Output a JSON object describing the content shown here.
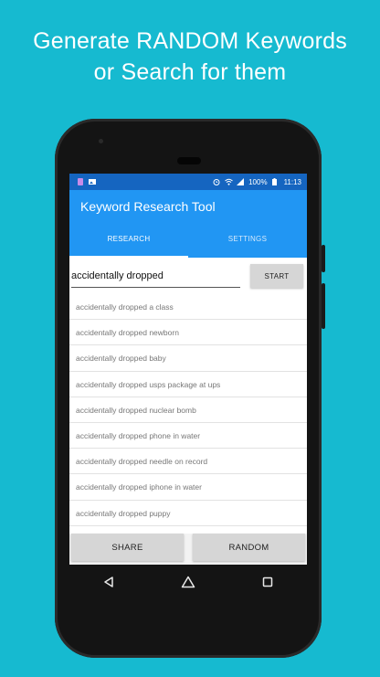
{
  "headline": {
    "line1": "Generate RANDOM Keywords",
    "line2": "or Search for them"
  },
  "status_bar": {
    "battery": "100%",
    "time": "11:13"
  },
  "app": {
    "title": "Keyword Research Tool",
    "tabs": [
      {
        "label": "RESEARCH",
        "active": true
      },
      {
        "label": "SETTINGS",
        "active": false
      }
    ],
    "search": {
      "value": "accidentally dropped",
      "start_label": "START"
    },
    "results": [
      "accidentally dropped a class",
      "accidentally dropped newborn",
      "accidentally dropped baby",
      "accidentally dropped usps package at ups",
      "accidentally dropped nuclear bomb",
      "accidentally dropped phone in water",
      "accidentally dropped needle on record",
      "accidentally dropped iphone in water",
      "accidentally dropped puppy"
    ],
    "share_label": "SHARE",
    "random_label": "RANDOM"
  },
  "colors": {
    "background": "#16bad0",
    "app_bar": "#2196f3",
    "status_bar": "#1565c0"
  }
}
